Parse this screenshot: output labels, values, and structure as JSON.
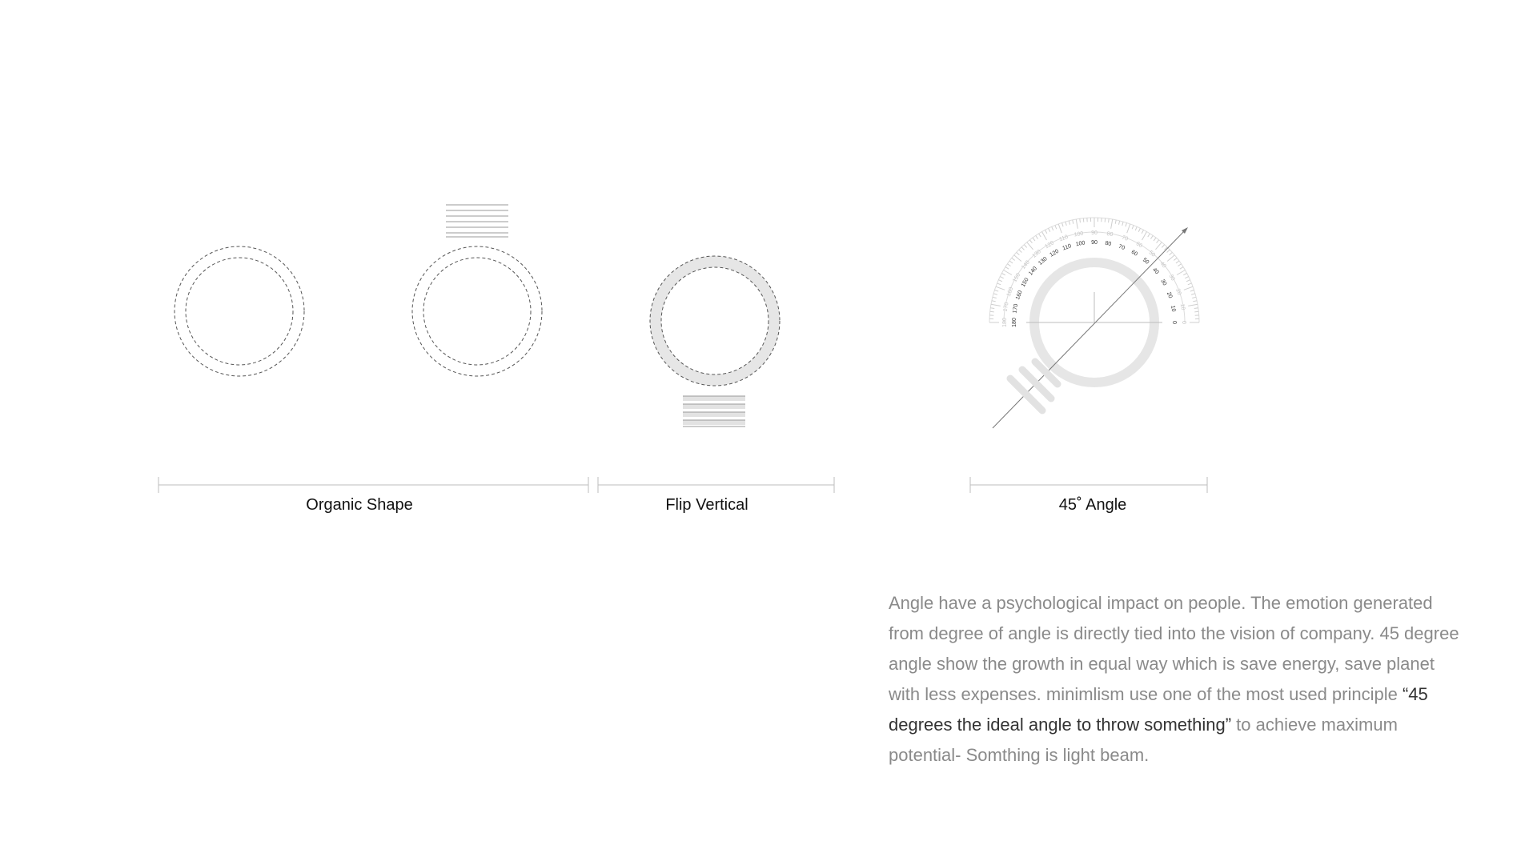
{
  "labels": {
    "organic_shape": "Organic Shape",
    "flip_vertical": "Flip Vertical",
    "angle": "45˚ Angle"
  },
  "description": {
    "before": "Angle have a psychological impact on people. The emotion generated from degree of angle is directly tied into the vision of company. 45 degree angle show the growth in equal way which is save energy, save planet with less expenses. minimlism use one of the most used principle ",
    "quote": "“45 degrees the ideal angle to throw something”",
    "after": " to achieve maximum potential- Somthing is light beam."
  },
  "protractor": {
    "outer_ticks": [
      "180",
      "170",
      "160",
      "150",
      "140",
      "130",
      "120",
      "110",
      "100",
      "90",
      "80",
      "70",
      "60",
      "50",
      "40",
      "30",
      "20",
      "10",
      "0"
    ],
    "inner_ticks": [
      "180",
      "170",
      "160",
      "150",
      "140",
      "130",
      "120",
      "110",
      "100",
      "90",
      "80",
      "70",
      "60",
      "50",
      "40",
      "30",
      "20",
      "10",
      "0"
    ]
  },
  "colors": {
    "line": "#bdbdbd",
    "ring_fill": "#e6e6e6",
    "text_dark": "#111111",
    "text_muted": "#8a8a8a",
    "dashed": "#555555"
  }
}
